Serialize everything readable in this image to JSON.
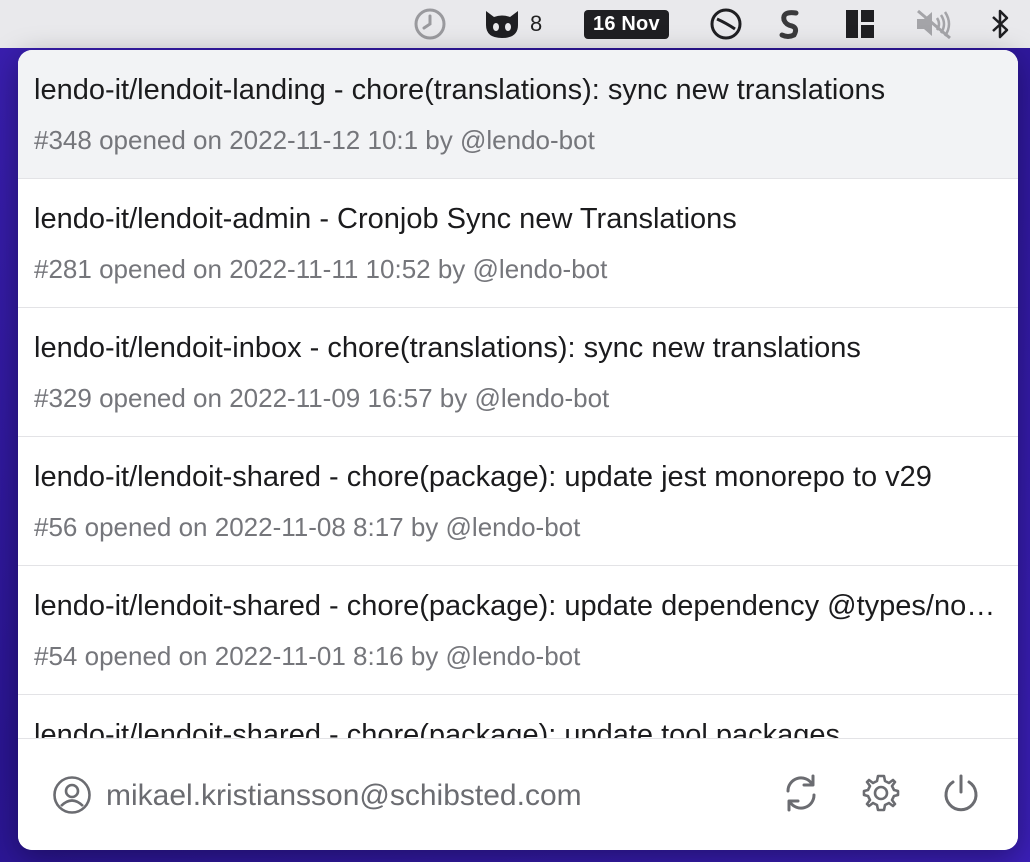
{
  "menubar": {
    "github_count": "8",
    "date_label": "16 Nov",
    "icons": [
      "history-icon",
      "github-icon",
      "calendar-date",
      "no-entry-icon",
      "dollar-icon",
      "layout-icon",
      "muted-speaker-icon",
      "bluetooth-icon"
    ]
  },
  "pull_requests": [
    {
      "title": "lendo-it/lendoit-landing - chore(translations): sync new translations",
      "meta": "#348 opened on 2022-11-12 10:1 by @lendo-bot"
    },
    {
      "title": "lendo-it/lendoit-admin - Cronjob Sync new Translations",
      "meta": "#281 opened on 2022-11-11 10:52 by @lendo-bot"
    },
    {
      "title": "lendo-it/lendoit-inbox - chore(translations): sync new translations",
      "meta": "#329 opened on 2022-11-09 16:57 by @lendo-bot"
    },
    {
      "title": "lendo-it/lendoit-shared - chore(package): update jest monorepo to v29",
      "meta": "#56 opened on 2022-11-08 8:17 by @lendo-bot"
    },
    {
      "title": "lendo-it/lendoit-shared - chore(package): update dependency @types/node",
      "meta": "#54 opened on 2022-11-01 8:16 by @lendo-bot"
    },
    {
      "title": "lendo-it/lendoit-shared - chore(package): update tool packages",
      "meta": ""
    }
  ],
  "footer": {
    "email": "mikael.kristiansson@schibsted.com"
  },
  "colors": {
    "accent_icon": "#6b6c71",
    "selected_row": "#f2f3f5",
    "background": "#2a1591"
  }
}
